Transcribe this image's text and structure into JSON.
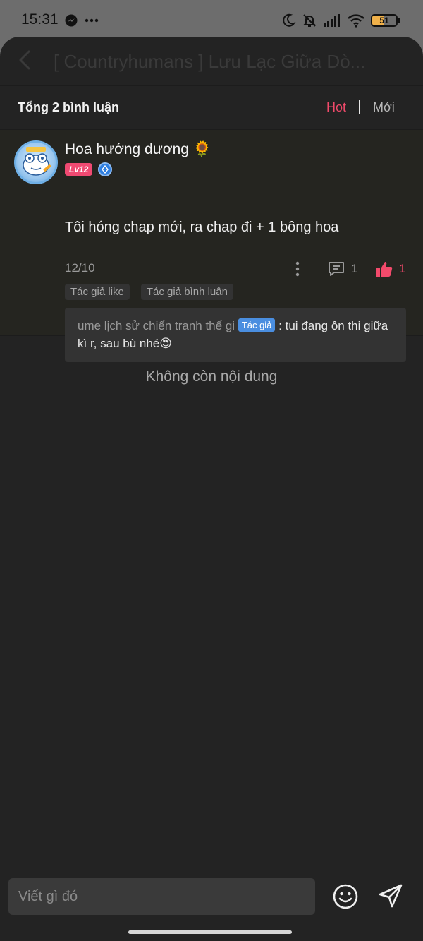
{
  "status_bar": {
    "time": "15:31",
    "battery_level": "51",
    "battery_fraction": 0.51,
    "icons": [
      "messenger-icon",
      "more-dots-icon",
      "moon-icon",
      "bell-off-icon",
      "signal-icon",
      "wifi-icon",
      "battery-icon"
    ]
  },
  "header": {
    "title": "[ Countryhumans ] Lưu Lạc Giữa Dò..."
  },
  "comments_summary": {
    "total_label": "Tổng 2 bình luận",
    "sort_hot": "Hot",
    "sort_new": "Mới"
  },
  "comment": {
    "user_name": "Hoa hướng dương 🌻",
    "level": "Lv12",
    "text": "Tôi hóng chap mới, ra chap đi + 1 bông hoa",
    "date": "12/10",
    "reply_count": "1",
    "like_count": "1",
    "tags": [
      "Tác giả like",
      "Tác giả bình luận"
    ],
    "reply": {
      "user": "ume lịch sử chiến tranh thế gi",
      "author_badge": "Tác giả",
      "separator": " : ",
      "text": "tui đang ôn thi giữa kì r, sau bù nhé😍"
    }
  },
  "end_message": "Không còn nội dung",
  "input_bar": {
    "placeholder": "Viết gì đó"
  },
  "colors": {
    "accent": "#f24a6b",
    "background": "#232323",
    "author_badge": "#4a8ee0",
    "level_badge": "#f04a72"
  }
}
